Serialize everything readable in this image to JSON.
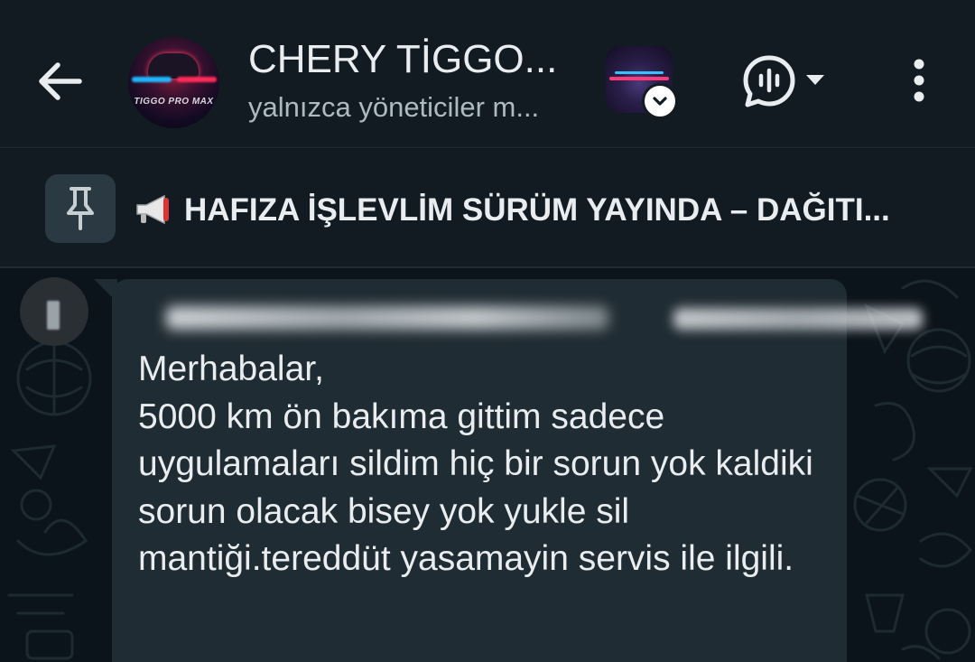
{
  "header": {
    "title": "CHERY TİGGO...",
    "subtitle": "yalnızca yöneticiler m...",
    "avatar_icon": "group-avatar",
    "community_icon": "community-avatar",
    "avatar_caption": "TIGGO PRO MAX"
  },
  "pinned": {
    "icon": "pin-icon",
    "emoji": "📢",
    "text": "HAFIZA İŞLEVLİM SÜRÜM YAYINDA – DAĞITI..."
  },
  "message": {
    "sender_name": "",
    "sender_phone": "",
    "text": "Merhabalar,\n5000 km ön bakıma gittim sadece uygulamaları sildim hiç bir sorun yok kaldiki sorun olacak bisey yok yukle sil mantiği.tereddüt yasamayin servis ile ilgili."
  },
  "colors": {
    "header_bg": "#111b21",
    "chat_bg": "#0b141a",
    "bubble_bg": "#202c33",
    "text_primary": "#e9edef",
    "text_secondary": "#aebac1"
  }
}
